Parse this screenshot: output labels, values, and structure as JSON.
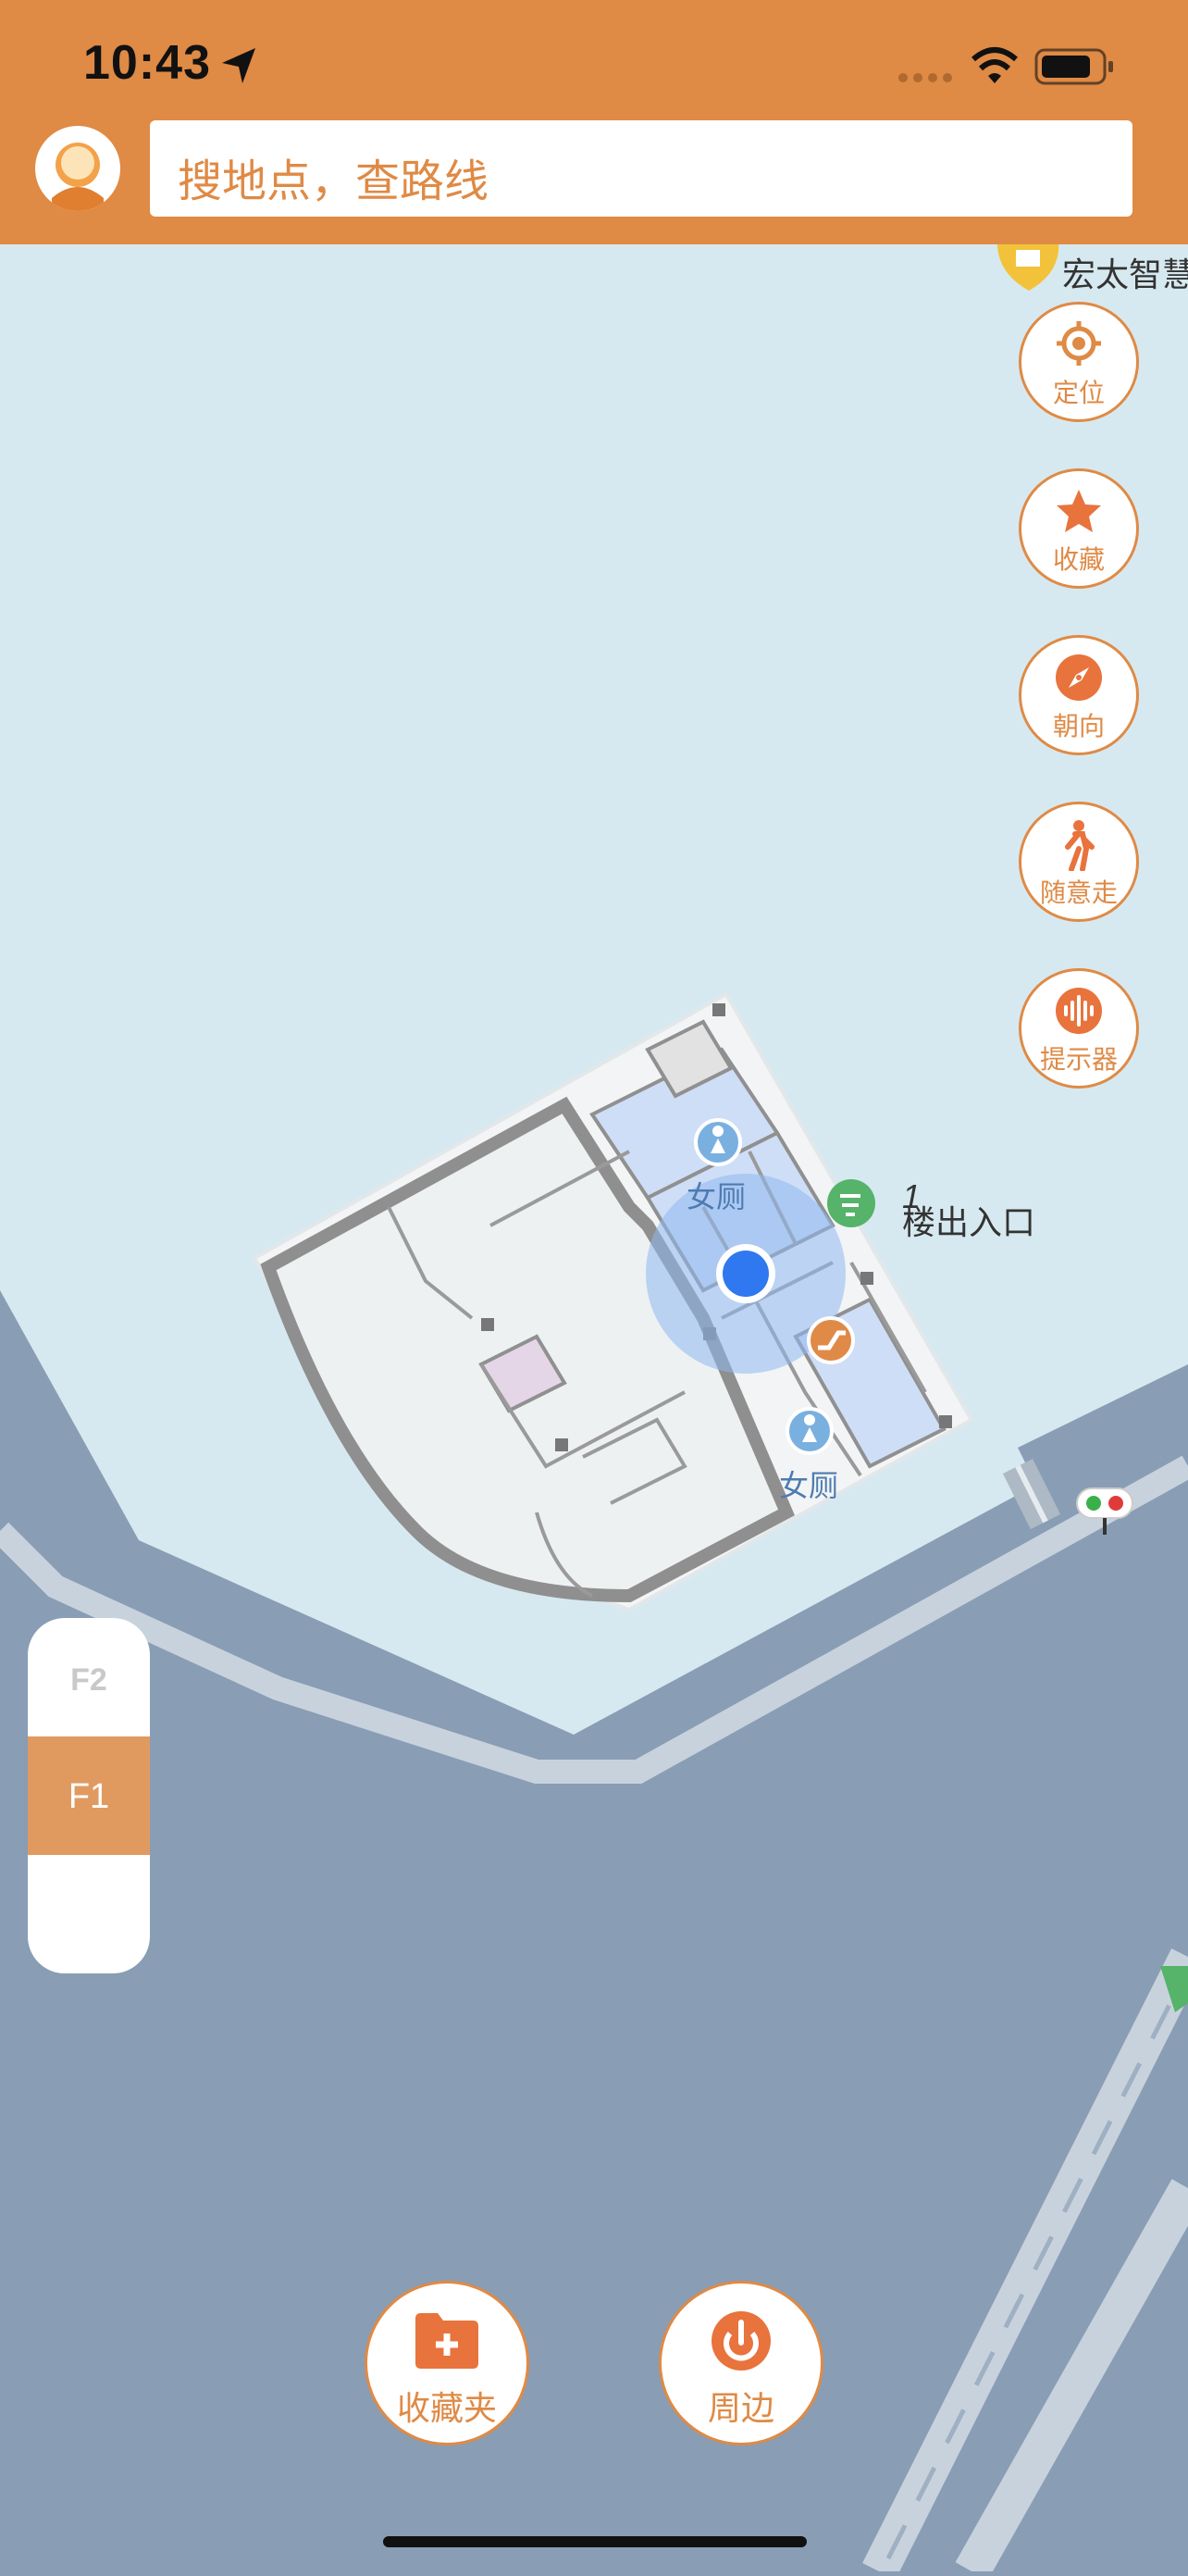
{
  "status_bar": {
    "time": "10:43"
  },
  "search": {
    "placeholder": "搜地点，查路线"
  },
  "map": {
    "top_poi_label": "宏太智慧",
    "entrance_label": "楼出入口",
    "entrance_number": "1",
    "restroom_labels": [
      "女厕",
      "女厕"
    ]
  },
  "right_buttons": [
    {
      "label": "定位",
      "icon": "locate-icon"
    },
    {
      "label": "收藏",
      "icon": "star-icon"
    },
    {
      "label": "朝向",
      "icon": "compass-icon"
    },
    {
      "label": "随意走",
      "icon": "walker-icon"
    },
    {
      "label": "提示器",
      "icon": "sound-wave-icon"
    }
  ],
  "floors": {
    "f2": "F2",
    "f1": "F1",
    "selected": "F1"
  },
  "bottom_buttons": [
    {
      "label": "收藏夹",
      "icon": "folder-plus-icon"
    },
    {
      "label": "周边",
      "icon": "nearby-icon"
    }
  ],
  "colors": {
    "accent": "#df8a45",
    "water": "#d7e9f0",
    "road_area": "#899db4",
    "location": "#2f78f0"
  }
}
